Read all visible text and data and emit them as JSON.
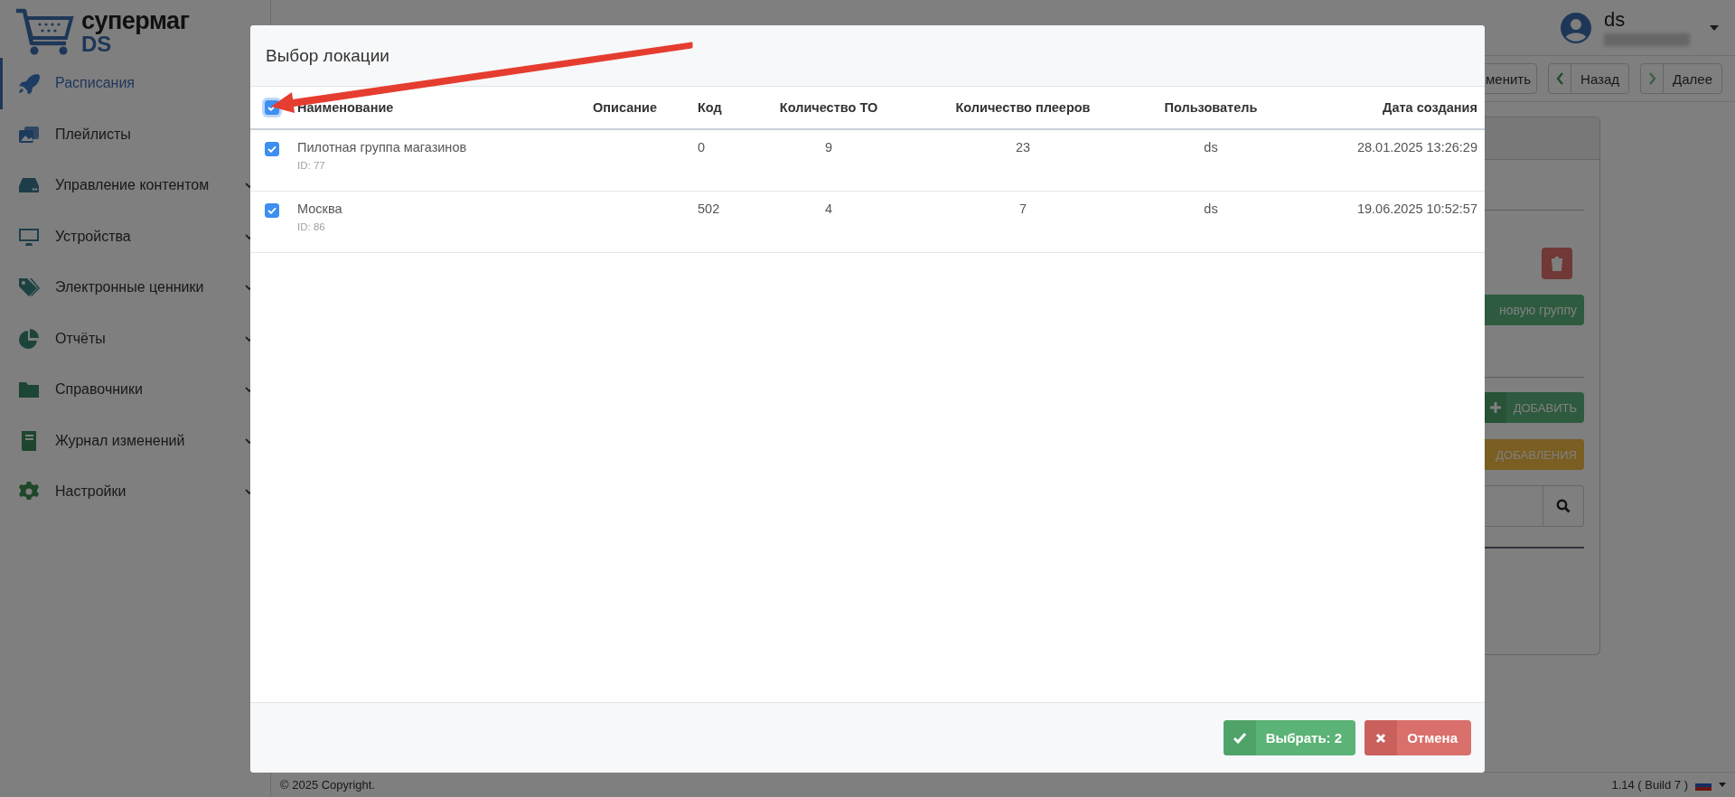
{
  "sidebar": {
    "logo": {
      "name": "супермаг",
      "suffix": "DS"
    },
    "items": [
      {
        "label": "Расписания",
        "selected": true,
        "has_submenu": false
      },
      {
        "label": "Плейлисты",
        "selected": false,
        "has_submenu": false
      },
      {
        "label": "Управление контентом",
        "selected": false,
        "has_submenu": true
      },
      {
        "label": "Устройства",
        "selected": false,
        "has_submenu": true
      },
      {
        "label": "Электронные ценники",
        "selected": false,
        "has_submenu": true
      },
      {
        "label": "Отчёты",
        "selected": false,
        "has_submenu": true
      },
      {
        "label": "Справочники",
        "selected": false,
        "has_submenu": true
      },
      {
        "label": "Журнал изменений",
        "selected": false,
        "has_submenu": true
      },
      {
        "label": "Настройки",
        "selected": false,
        "has_submenu": true
      }
    ]
  },
  "header": {
    "user": {
      "name": "ds"
    }
  },
  "toolbar": [
    {
      "label": "менить",
      "kind": "plain"
    },
    {
      "label": "Назад",
      "kind": "prev"
    },
    {
      "label": "Далее",
      "kind": "next"
    }
  ],
  "panel": {
    "buttons": [
      {
        "label": "новую группу",
        "kind": "green"
      },
      {
        "label": "ДОБАВИТЬ",
        "kind": "add"
      },
      {
        "label": "ДОБАВЛЕНИЯ",
        "kind": "yellow"
      }
    ]
  },
  "modal": {
    "title": "Выбор локации",
    "select_all": {
      "checked": true
    },
    "columns": [
      "Наименование",
      "Описание",
      "Код",
      "Количество ТО",
      "Количество плееров",
      "Пользователь",
      "Дата создания"
    ],
    "rows": [
      {
        "checked": true,
        "name": "Пилотная группа магазинов",
        "id": "ID: 77",
        "code": "0",
        "to_count": "9",
        "player_count": "23",
        "user": "ds",
        "created": "28.01.2025 13:26:29"
      },
      {
        "checked": true,
        "name": "Москва",
        "id": "ID: 86",
        "code": "502",
        "to_count": "4",
        "player_count": "7",
        "user": "ds",
        "created": "19.06.2025 10:52:57"
      }
    ],
    "buttons": [
      {
        "label": "Выбрать: 2",
        "kind": "confirm"
      },
      {
        "label": "Отмена",
        "kind": "cancel"
      }
    ]
  },
  "footer": {
    "copyright": "© 2025 Copyright.",
    "version": "1.14 ( Build 7 )"
  }
}
